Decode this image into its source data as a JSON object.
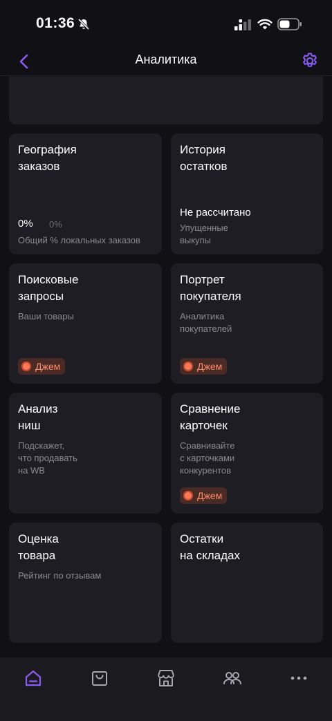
{
  "status_bar": {
    "time": "01:36"
  },
  "header": {
    "title": "Аналитика"
  },
  "cards": {
    "geography": {
      "title_line1": "География",
      "title_line2": "заказов",
      "stat_main": "0%",
      "stat_secondary": "0%",
      "subtitle": "Общий % локальных заказов"
    },
    "stock_history": {
      "title_line1": "История",
      "title_line2": "остатков",
      "status": "Не рассчитано",
      "sub_line1": "Упущенные",
      "sub_line2": "выкупы"
    },
    "search_queries": {
      "title_line1": "Поисковые",
      "title_line2": "запросы",
      "subtitle": "Ваши товары",
      "badge": "Джем"
    },
    "buyer_portrait": {
      "title_line1": "Портрет",
      "title_line2": "покупателя",
      "sub_line1": "Аналитика",
      "sub_line2": "покупателей",
      "badge": "Джем"
    },
    "niche_analysis": {
      "title_line1": "Анализ",
      "title_line2": "ниш",
      "sub_line1": "Подскажет,",
      "sub_line2": "что продавать",
      "sub_line3": "на WB"
    },
    "card_comparison": {
      "title_line1": "Сравнение",
      "title_line2": "карточек",
      "sub_line1": "Сравнивайте",
      "sub_line2": "с карточками",
      "sub_line3": "конкурентов",
      "badge": "Джем"
    },
    "product_rating": {
      "title_line1": "Оценка",
      "title_line2": "товара",
      "subtitle": "Рейтинг по отзывам"
    },
    "warehouse_stock": {
      "title_line1": "Остатки",
      "title_line2": "на складах"
    }
  },
  "tab_bar": {
    "items": [
      {
        "icon": "home-icon",
        "active": true
      },
      {
        "icon": "shopping-bag-icon",
        "active": false
      },
      {
        "icon": "store-icon",
        "active": false
      },
      {
        "icon": "users-icon",
        "active": false
      },
      {
        "icon": "more-icon",
        "active": false
      }
    ]
  },
  "colors": {
    "accent": "#8b5cf6",
    "background": "#111014",
    "card": "#1f1d24",
    "badge_text": "#ff8d6a"
  }
}
